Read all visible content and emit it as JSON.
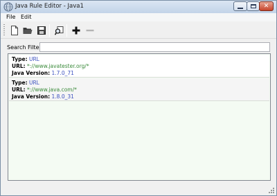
{
  "window": {
    "title": "Java Rule Editor - Java1",
    "icon": "globe-window-icon",
    "controls": {
      "minimize": "minimize-icon",
      "maximize": "maximize-icon",
      "close": "close-icon"
    }
  },
  "menubar": {
    "items": [
      {
        "label": "File"
      },
      {
        "label": "Edit"
      }
    ]
  },
  "toolbar": {
    "buttons": [
      {
        "icon": "new-document-icon"
      },
      {
        "icon": "open-folder-icon"
      },
      {
        "icon": "save-disk-icon"
      },
      {
        "icon": "find-icon"
      },
      {
        "icon": "add-icon"
      },
      {
        "icon": "remove-icon",
        "disabled": true
      }
    ]
  },
  "search": {
    "label": "Search Filter:",
    "value": ""
  },
  "rules": [
    {
      "type_label": "Type:",
      "type": "URL",
      "url_label": "URL:",
      "url": "*://www.javatester.org/*",
      "version_label": "Java Version:",
      "version": "1.7.0_71"
    },
    {
      "type_label": "Type:",
      "type": "URL",
      "url_label": "URL:",
      "url": "*://www.java.com/*",
      "version_label": "Java Version:",
      "version": "1.8.0_31"
    }
  ],
  "colors": {
    "value_blue": "#3a4fbf",
    "url_green": "#3a8a3a",
    "list_background": "#f4fbf3"
  }
}
